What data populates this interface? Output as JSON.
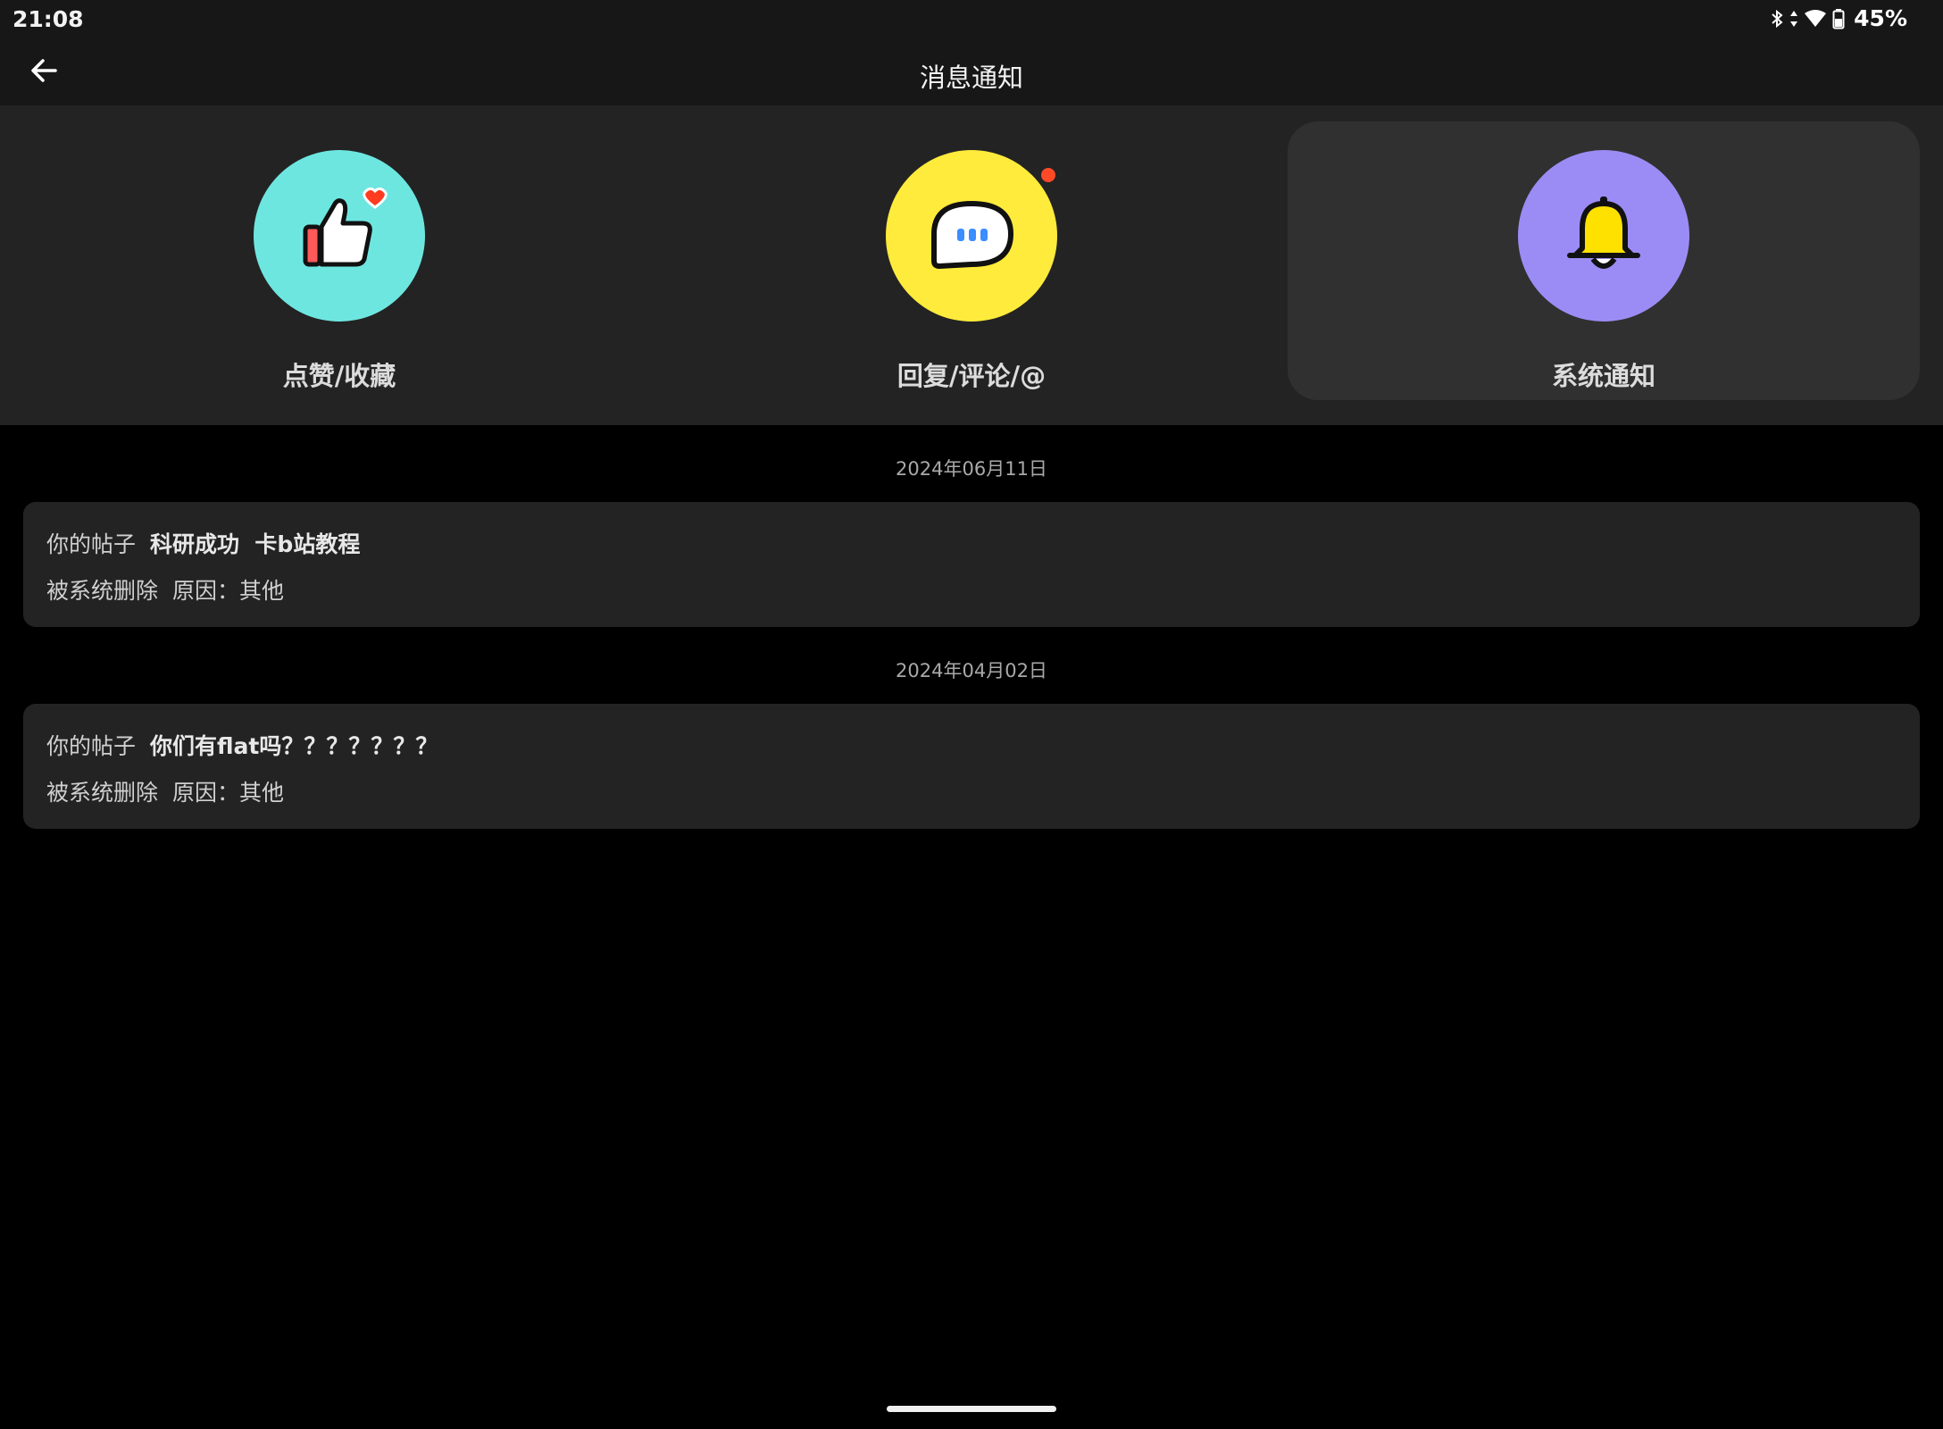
{
  "status_bar": {
    "time": "21:08",
    "battery_percent": "45%",
    "icons": [
      "bluetooth-icon",
      "data-arrows-icon",
      "wifi-icon",
      "battery-icon"
    ]
  },
  "app_bar": {
    "back_icon": "arrow-left-icon",
    "title": "消息通知"
  },
  "categories": [
    {
      "label": "点赞/收藏",
      "icon": "thumbs-up-heart-icon",
      "color": "#6EE6E0",
      "has_badge": false,
      "active": false
    },
    {
      "label": "回复/评论/@",
      "icon": "chat-bubble-icon",
      "color": "#FFEB3B",
      "has_badge": true,
      "active": false
    },
    {
      "label": "系统通知",
      "icon": "bell-icon",
      "color": "#9B8CF5",
      "has_badge": false,
      "active": true
    }
  ],
  "notices": [
    {
      "date": "2024年06月11日",
      "prefix": "你的帖子",
      "post_title": "科研成功  卡b站教程",
      "action": "被系统删除",
      "reason": "原因：其他"
    },
    {
      "date": "2024年04月02日",
      "prefix": "你的帖子",
      "post_title": "你们有flat吗？？？？？？？",
      "action": "被系统删除",
      "reason": "原因：其他"
    }
  ],
  "colors": {
    "badge": "#FF4A28",
    "background": "#000000",
    "panel": "#232323"
  }
}
